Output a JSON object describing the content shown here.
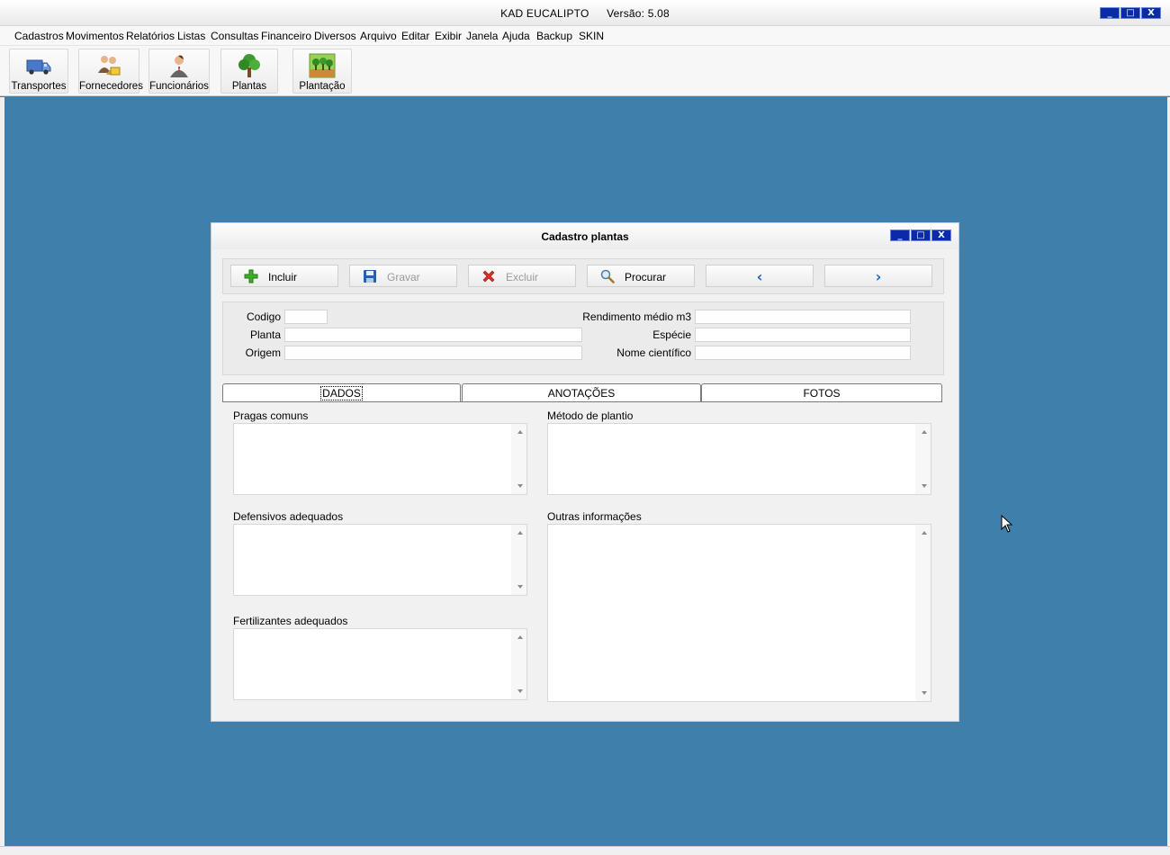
{
  "app": {
    "title": "KAD EUCALIPTO",
    "version": "Versão: 5.08",
    "window_buttons": {
      "minimize": "_",
      "maximize": "□",
      "close": "X"
    }
  },
  "menu": [
    {
      "label": "Cadastros"
    },
    {
      "label": "Movimentos"
    },
    {
      "label": "Relatórios"
    },
    {
      "label": "Listas"
    },
    {
      "label": "Consultas"
    },
    {
      "label": "Financeiro"
    },
    {
      "label": "Diversos"
    },
    {
      "label": "Arquivo"
    },
    {
      "label": "Editar"
    },
    {
      "label": "Exibir"
    },
    {
      "label": "Janela"
    },
    {
      "label": "Ajuda"
    },
    {
      "label": "Backup"
    },
    {
      "label": "SKIN"
    }
  ],
  "toolbar": [
    {
      "label": "Transportes",
      "icon": "truck-icon"
    },
    {
      "label": "Fornecedores",
      "icon": "suppliers-icon"
    },
    {
      "label": "Funcionários",
      "icon": "employee-icon"
    },
    {
      "label": "Plantas",
      "icon": "tree-icon"
    },
    {
      "label": "Plantação",
      "icon": "plantation-icon"
    }
  ],
  "child_window": {
    "title": "Cadastro plantas",
    "actions": {
      "incluir": {
        "label": "Incluir",
        "icon": "plus-icon",
        "enabled": true
      },
      "gravar": {
        "label": "Gravar",
        "icon": "floppy-icon",
        "enabled": false
      },
      "excluir": {
        "label": "Excluir",
        "icon": "x-delete-icon",
        "enabled": false
      },
      "procurar": {
        "label": "Procurar",
        "icon": "magnifier-icon",
        "enabled": true
      },
      "prev": {
        "symbol": "‹",
        "icon": "arrow-left-icon"
      },
      "next": {
        "symbol": "›",
        "icon": "arrow-right-icon"
      }
    },
    "fields": {
      "codigo": {
        "label": "Codigo",
        "value": ""
      },
      "planta": {
        "label": "Planta",
        "value": ""
      },
      "origem": {
        "label": "Origem",
        "value": ""
      },
      "rendimento": {
        "label": "Rendimento médio m3",
        "value": ""
      },
      "especie": {
        "label": "Espécie",
        "value": ""
      },
      "nome_cientifico": {
        "label": "Nome científico",
        "value": ""
      }
    },
    "tabs": [
      {
        "label": "DADOS",
        "active": true
      },
      {
        "label": "ANOTAÇÕES",
        "active": false
      },
      {
        "label": "FOTOS",
        "active": false
      }
    ],
    "dados": {
      "pragas": {
        "label": "Pragas comuns",
        "value": ""
      },
      "defensivos": {
        "label": "Defensivos adequados",
        "value": ""
      },
      "fertilizantes": {
        "label": "Fertilizantes adequados",
        "value": ""
      },
      "metodo": {
        "label": "Método de plantio",
        "value": ""
      },
      "outras": {
        "label": "Outras informações",
        "value": ""
      }
    }
  },
  "colors": {
    "desktop": "#3e7fab",
    "title_button": "#0a2aa8",
    "nav_arrow": "#1c5fc2"
  }
}
